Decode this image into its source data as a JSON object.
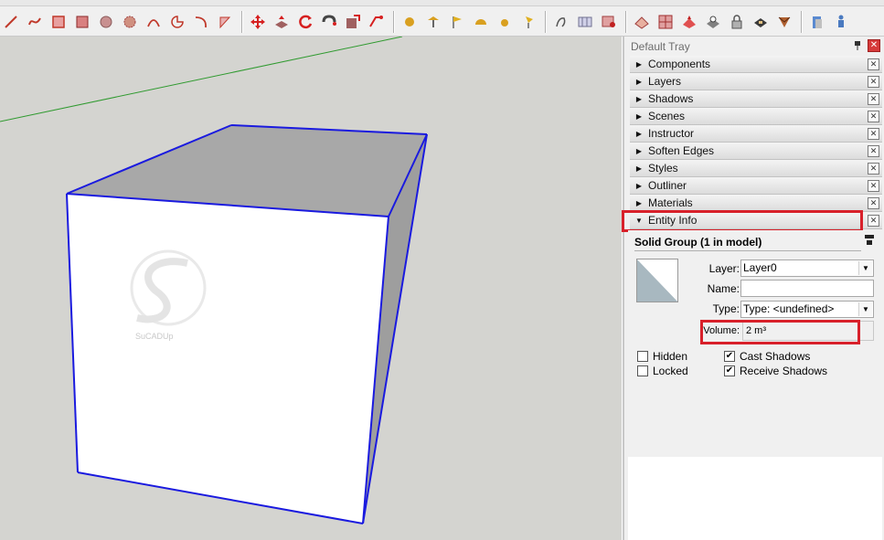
{
  "tray": {
    "title": "Default Tray",
    "pin_icon": "pin-icon",
    "close_icon": "close-icon",
    "panels": [
      {
        "label": "Components",
        "expanded": false
      },
      {
        "label": "Layers",
        "expanded": false
      },
      {
        "label": "Shadows",
        "expanded": false
      },
      {
        "label": "Scenes",
        "expanded": false
      },
      {
        "label": "Instructor",
        "expanded": false
      },
      {
        "label": "Soften Edges",
        "expanded": false
      },
      {
        "label": "Styles",
        "expanded": false
      },
      {
        "label": "Outliner",
        "expanded": false
      },
      {
        "label": "Materials",
        "expanded": false
      },
      {
        "label": "Entity Info",
        "expanded": true
      }
    ]
  },
  "entity_info": {
    "title": "Solid Group (1 in model)",
    "layer_label": "Layer:",
    "layer_value": "Layer0",
    "name_label": "Name:",
    "name_value": "",
    "type_label": "Type:",
    "type_value": "Type: <undefined>",
    "volume_label": "Volume:",
    "volume_value": "2 m³",
    "hidden_label": "Hidden",
    "hidden_checked": false,
    "locked_label": "Locked",
    "locked_checked": false,
    "cast_shadows_label": "Cast Shadows",
    "cast_shadows_checked": true,
    "receive_shadows_label": "Receive Shadows",
    "receive_shadows_checked": true
  },
  "watermark": "SuCADUp",
  "colors": {
    "highlight": "#d8202a",
    "edge": "#1a1adf",
    "green_axis": "#2f9a2f",
    "viewport_bg": "#d4d4d0"
  }
}
